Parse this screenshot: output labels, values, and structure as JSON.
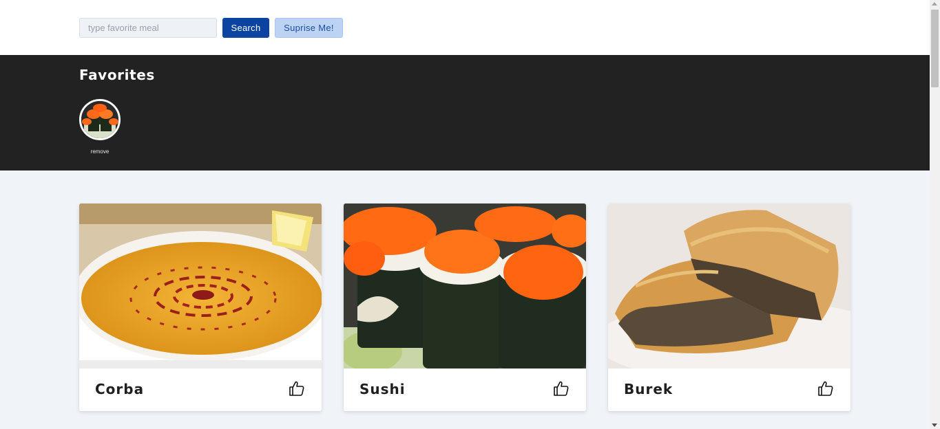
{
  "search": {
    "placeholder": "type favorite meal",
    "value": "",
    "search_label": "Search",
    "surprise_label": "Suprise Me!"
  },
  "favorites": {
    "title": "Favorites",
    "items": [
      {
        "meal": "Sushi",
        "remove_label": "remove"
      }
    ]
  },
  "meals": [
    {
      "name": "Corba",
      "icon": "thumbs-up-icon"
    },
    {
      "name": "Sushi",
      "icon": "thumbs-up-icon"
    },
    {
      "name": "Burek",
      "icon": "thumbs-up-icon"
    }
  ],
  "colors": {
    "primary_button": "#0a44a0",
    "secondary_button": "#bcd3f6",
    "favorites_bg": "#222222",
    "page_bg": "#f0f3f8"
  }
}
